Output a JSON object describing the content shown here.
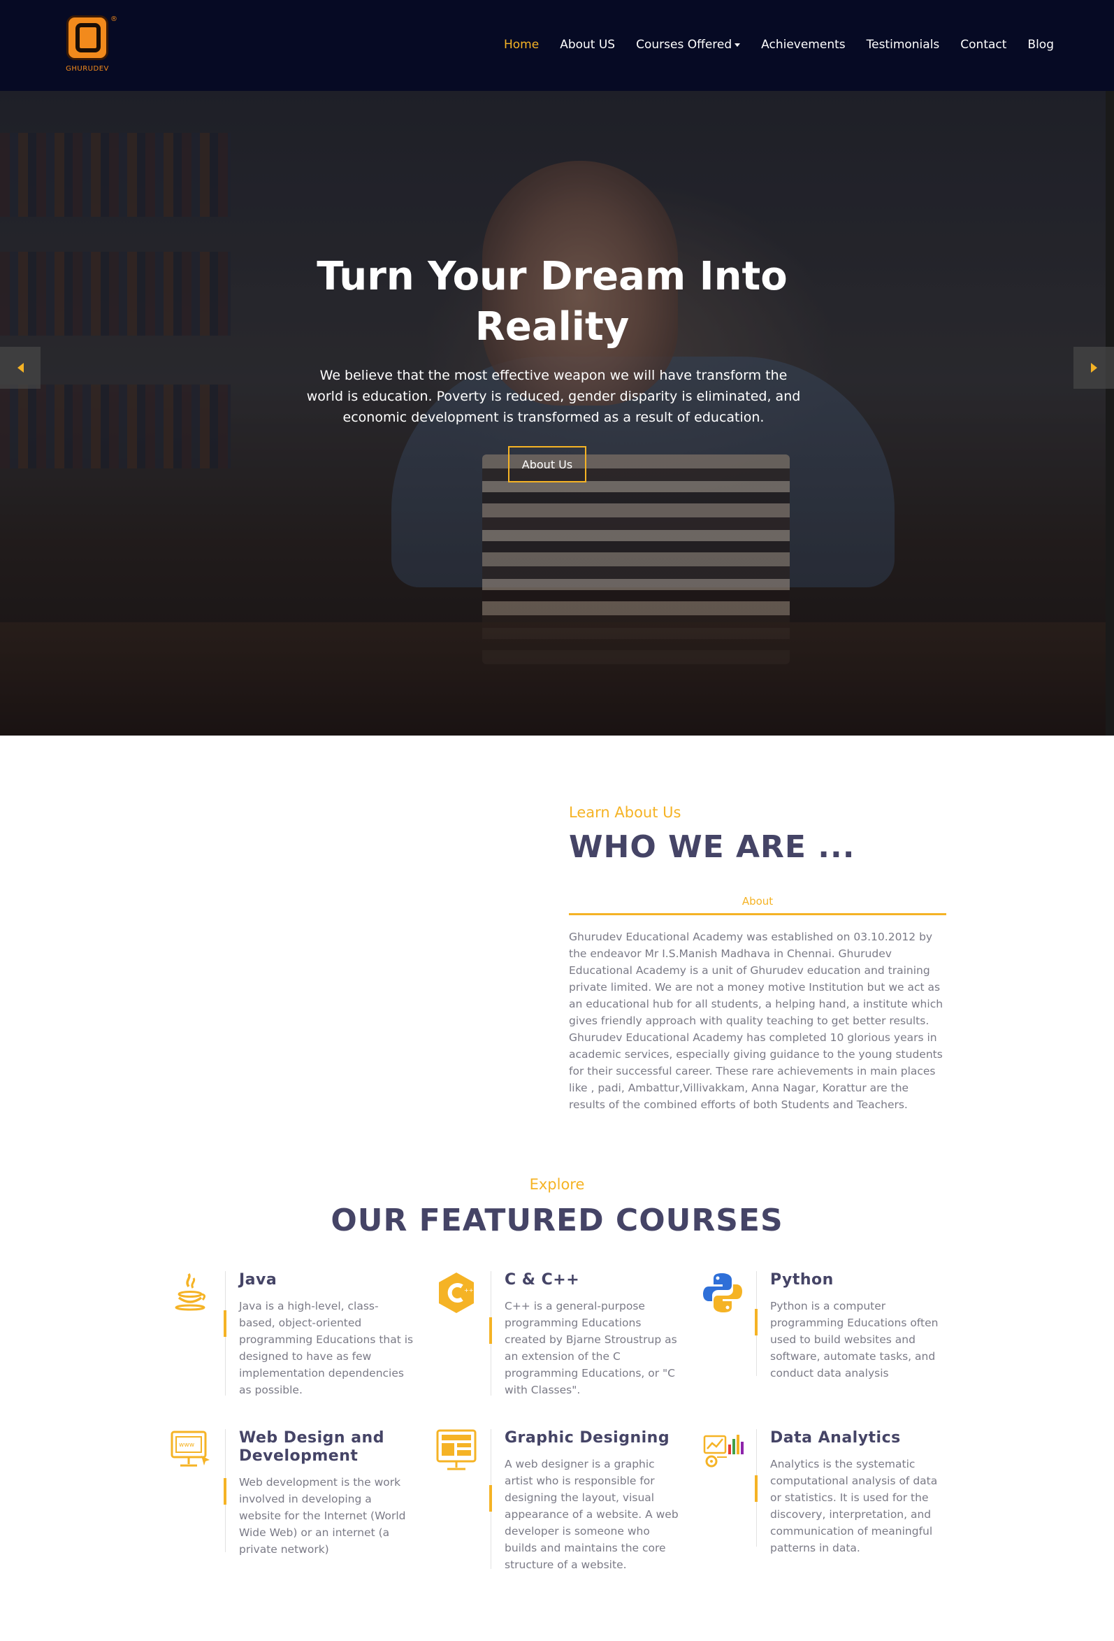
{
  "brand": {
    "logo_text": "GHURUDEV",
    "reg_mark": "®",
    "accent": "#f5b325",
    "dark": "#060a24",
    "heading": "#454466"
  },
  "nav": {
    "items": [
      {
        "label": "Home",
        "active": true
      },
      {
        "label": "About US"
      },
      {
        "label": "Courses Offered",
        "dropdown": true
      },
      {
        "label": "Achievements"
      },
      {
        "label": "Testimonials"
      },
      {
        "label": "Contact"
      },
      {
        "label": "Blog"
      }
    ]
  },
  "hero": {
    "title": "Turn Your Dream Into Reality",
    "text": "We believe that the most effective weapon we will have transform the world is education. Poverty is reduced, gender disparity is eliminated, and economic development is transformed as a result of education.",
    "button": "About Us",
    "prev_icon": "chevron-left-icon",
    "next_icon": "chevron-right-icon"
  },
  "about": {
    "subtitle": "Learn About Us",
    "title": "WHO WE ARE ...",
    "tab": "About",
    "text": "Ghurudev Educational Academy was established on 03.10.2012 by the endeavor Mr I.S.Manish Madhava in Chennai. Ghurudev Educational Academy is a unit of Ghurudev education and training private limited. We are not a money motive Institution but we act as an educational hub for all students, a helping hand, a institute which gives friendly approach with quality teaching to get better results. Ghurudev Educational Academy has completed 10 glorious years in academic services, especially giving guidance to the young students for their successful career. These rare achievements in main places like , padi, Ambattur,Villivakkam, Anna Nagar, Korattur are the results of the combined efforts of both Students and Teachers."
  },
  "courses": {
    "subtitle": "Explore",
    "title": "OUR FEATURED COURSES",
    "items": [
      {
        "name": "Java",
        "icon": "java-icon",
        "desc": "Java is a high-level, class-based, object-oriented programming Educations that is designed to have as few implementation dependencies as possible."
      },
      {
        "name": "C & C++",
        "icon": "cpp-icon",
        "desc": "C++ is a general-purpose programming Educations created by Bjarne Stroustrup as an extension of the C programming Educations, or \"C with Classes\"."
      },
      {
        "name": "Python",
        "icon": "python-icon",
        "desc": "Python is a computer programming Educations often used to build websites and software, automate tasks, and conduct data analysis"
      },
      {
        "name": "Web Design and Development",
        "icon": "web-design-icon",
        "desc": "Web development is the work involved in developing a website for the Internet (World Wide Web) or an internet (a private network)"
      },
      {
        "name": "Graphic Designing",
        "icon": "graphic-design-icon",
        "desc": "A web designer is a graphic artist who is responsible for designing the layout, visual appearance of a website. A web developer is someone who builds and maintains the core structure of a website."
      },
      {
        "name": "Data Analytics",
        "icon": "data-analytics-icon",
        "desc": "Analytics is the systematic computational analysis of data or statistics. It is used for the discovery, interpretation, and communication of meaningful patterns in data."
      }
    ]
  }
}
